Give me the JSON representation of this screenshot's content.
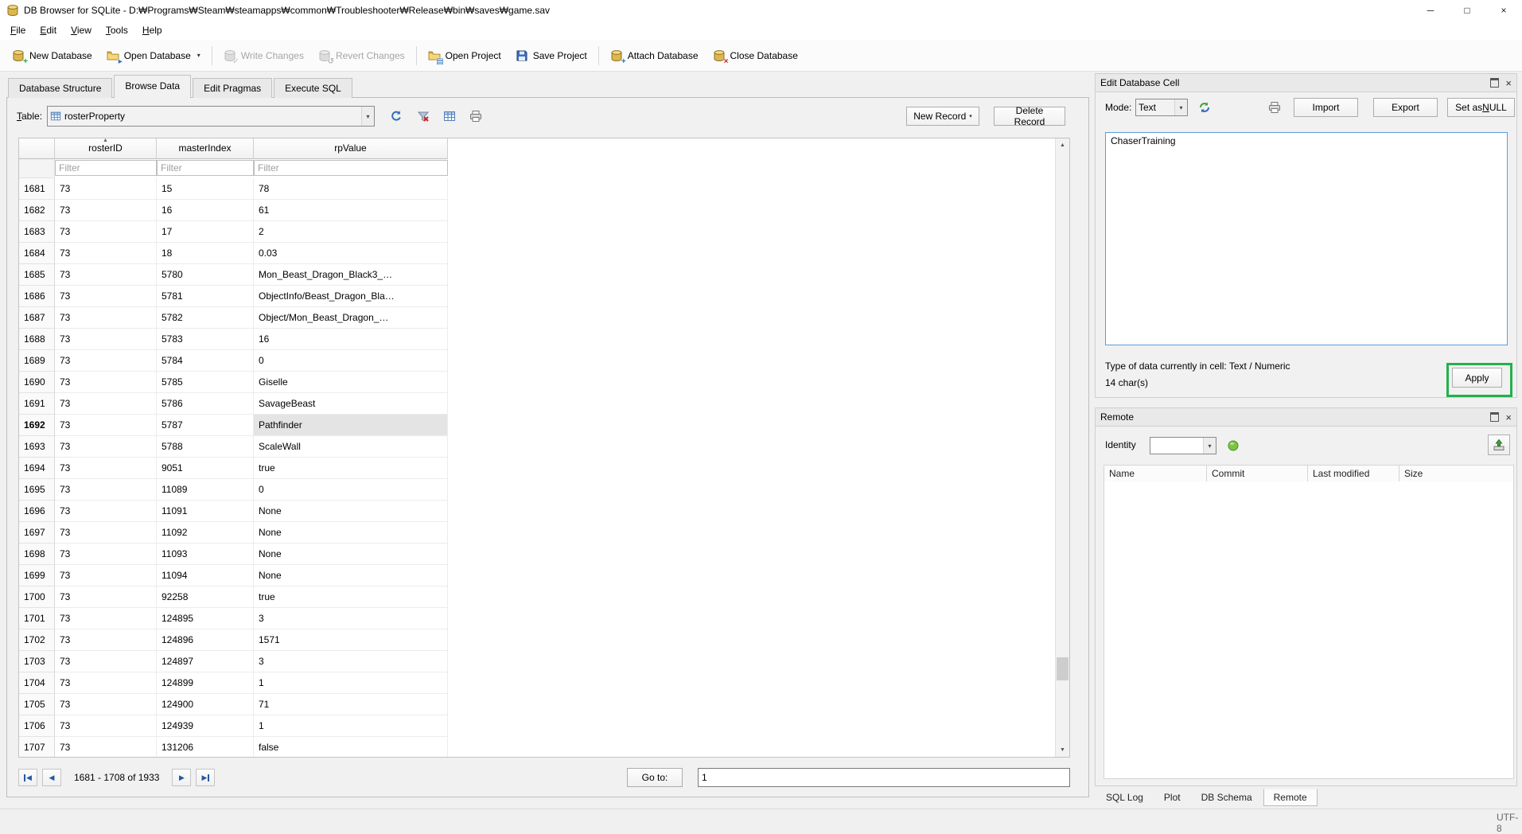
{
  "window": {
    "title": "DB Browser for SQLite - D:₩Programs₩Steam₩steamapps₩common₩Troubleshooter₩Release₩bin₩saves₩game.sav",
    "minimize_glyph": "─",
    "maximize_glyph": "□",
    "close_glyph": "×"
  },
  "menu": {
    "items": [
      "File",
      "Edit",
      "View",
      "Tools",
      "Help"
    ]
  },
  "toolbar": {
    "items": [
      {
        "label": "New Database",
        "name": "new-database",
        "group": 1,
        "enabled": true
      },
      {
        "label": "Open Database",
        "name": "open-database",
        "group": 1,
        "enabled": true,
        "dropdown": true
      },
      {
        "label": "Write Changes",
        "name": "write-changes",
        "group": 2,
        "enabled": false
      },
      {
        "label": "Revert Changes",
        "name": "revert-changes",
        "group": 2,
        "enabled": false
      },
      {
        "label": "Open Project",
        "name": "open-project",
        "group": 3,
        "enabled": true
      },
      {
        "label": "Save Project",
        "name": "save-project",
        "group": 3,
        "enabled": true
      },
      {
        "label": "Attach Database",
        "name": "attach-database",
        "group": 4,
        "enabled": true
      },
      {
        "label": "Close Database",
        "name": "close-database",
        "group": 4,
        "enabled": true
      }
    ]
  },
  "icons": {
    "new-database": {
      "base": "db",
      "badge": "+",
      "badge_color": "#1fa230"
    },
    "open-database": {
      "base": "folder",
      "badge": "▸",
      "badge_color": "#2f6fbd"
    },
    "write-changes": {
      "base": "db",
      "badge": "✓",
      "badge_color": "#2f6fbd"
    },
    "revert-changes": {
      "base": "db",
      "badge": "↺",
      "badge_color": "#c43c2e"
    },
    "open-project": {
      "base": "folder",
      "badge": "▤",
      "badge_color": "#2f6fbd"
    },
    "save-project": {
      "base": "floppy",
      "badge": "",
      "badge_color": ""
    },
    "attach-database": {
      "base": "db",
      "badge": "+",
      "badge_color": "#2f6fbd"
    },
    "close-database": {
      "base": "db",
      "badge": "×",
      "badge_color": "#d11a1a"
    }
  },
  "glyphs": {
    "dropdown": "▾",
    "sort_asc": "▲",
    "scroll_up": "▲",
    "scroll_down": "▼",
    "prev": "◀",
    "next": "▶",
    "close": "×"
  },
  "main_tabs": {
    "items": [
      "Database Structure",
      "Browse Data",
      "Edit Pragmas",
      "Execute SQL"
    ],
    "active": "Browse Data"
  },
  "browse": {
    "table_label": "Table:",
    "table_value": "rosterProperty",
    "new_record_label": "New Record",
    "delete_record_label": "Delete Record",
    "range_text": "1681 - 1708 of 1933",
    "goto_label": "Go to:",
    "goto_value": "1"
  },
  "table": {
    "columns": [
      "rosterID",
      "masterIndex",
      "rpValue"
    ],
    "filter_placeholder": "Filter",
    "sort": {
      "column": "rosterID",
      "direction": "asc"
    },
    "selected": {
      "row": 1692,
      "column": "rpValue"
    },
    "rows": [
      [
        1681,
        "73",
        "15",
        "78"
      ],
      [
        1682,
        "73",
        "16",
        "61"
      ],
      [
        1683,
        "73",
        "17",
        "2"
      ],
      [
        1684,
        "73",
        "18",
        "0.03"
      ],
      [
        1685,
        "73",
        "5780",
        "Mon_Beast_Dragon_Black3_…"
      ],
      [
        1686,
        "73",
        "5781",
        "ObjectInfo/Beast_Dragon_Bla…"
      ],
      [
        1687,
        "73",
        "5782",
        "Object/Mon_Beast_Dragon_…"
      ],
      [
        1688,
        "73",
        "5783",
        "16"
      ],
      [
        1689,
        "73",
        "5784",
        "0"
      ],
      [
        1690,
        "73",
        "5785",
        "Giselle"
      ],
      [
        1691,
        "73",
        "5786",
        "SavageBeast"
      ],
      [
        1692,
        "73",
        "5787",
        "Pathfinder"
      ],
      [
        1693,
        "73",
        "5788",
        "ScaleWall"
      ],
      [
        1694,
        "73",
        "9051",
        "true"
      ],
      [
        1695,
        "73",
        "11089",
        "0"
      ],
      [
        1696,
        "73",
        "11091",
        "None"
      ],
      [
        1697,
        "73",
        "11092",
        "None"
      ],
      [
        1698,
        "73",
        "11093",
        "None"
      ],
      [
        1699,
        "73",
        "11094",
        "None"
      ],
      [
        1700,
        "73",
        "92258",
        "true"
      ],
      [
        1701,
        "73",
        "124895",
        "3"
      ],
      [
        1702,
        "73",
        "124896",
        "1571"
      ],
      [
        1703,
        "73",
        "124897",
        "3"
      ],
      [
        1704,
        "73",
        "124899",
        "1"
      ],
      [
        1705,
        "73",
        "124900",
        "71"
      ],
      [
        1706,
        "73",
        "124939",
        "1"
      ],
      [
        1707,
        "73",
        "131206",
        "false"
      ]
    ]
  },
  "edit_cell": {
    "title": "Edit Database Cell",
    "mode_label": "Mode:",
    "mode_value": "Text",
    "import_label": "Import",
    "export_label": "Export",
    "set_null_label": "Set as NULL",
    "content": "ChaserTraining",
    "type_info": "Type of data currently in cell: Text / Numeric",
    "char_count": "14 char(s)",
    "apply_label": "Apply",
    "annotation_color": "#22b14c"
  },
  "remote": {
    "title": "Remote",
    "identity_label": "Identity",
    "columns": [
      "Name",
      "Commit",
      "Last modified",
      "Size"
    ]
  },
  "dock_tabs": {
    "items": [
      "SQL Log",
      "Plot",
      "DB Schema",
      "Remote"
    ],
    "active": "Remote"
  },
  "status": {
    "encoding": "UTF-8"
  }
}
